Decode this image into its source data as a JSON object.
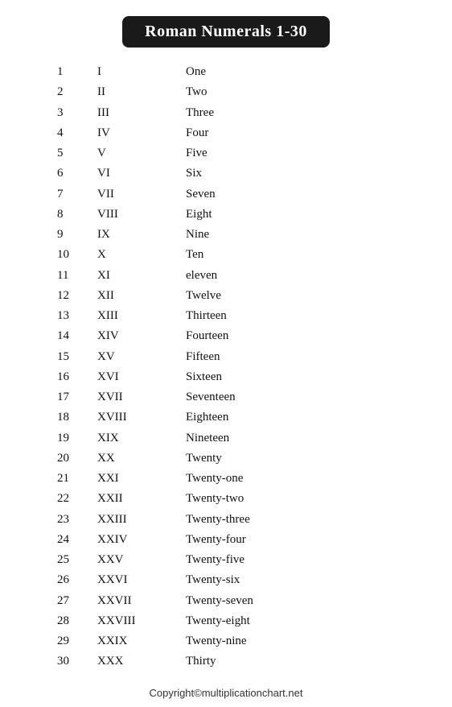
{
  "title": "Roman Numerals 1-30",
  "rows": [
    {
      "num": "1",
      "roman": "I",
      "word": "One"
    },
    {
      "num": "2",
      "roman": "II",
      "word": "Two"
    },
    {
      "num": "3",
      "roman": "III",
      "word": "Three"
    },
    {
      "num": "4",
      "roman": "IV",
      "word": "Four"
    },
    {
      "num": "5",
      "roman": "V",
      "word": "Five"
    },
    {
      "num": "6",
      "roman": "VI",
      "word": "Six"
    },
    {
      "num": "7",
      "roman": "VII",
      "word": "Seven"
    },
    {
      "num": "8",
      "roman": "VIII",
      "word": "Eight"
    },
    {
      "num": "9",
      "roman": "IX",
      "word": "Nine"
    },
    {
      "num": "10",
      "roman": "X",
      "word": "Ten"
    },
    {
      "num": "11",
      "roman": "XI",
      "word": "eleven"
    },
    {
      "num": "12",
      "roman": "XII",
      "word": "Twelve"
    },
    {
      "num": "13",
      "roman": "XIII",
      "word": "Thirteen"
    },
    {
      "num": "14",
      "roman": "XIV",
      "word": "Fourteen"
    },
    {
      "num": "15",
      "roman": "XV",
      "word": "Fifteen"
    },
    {
      "num": "16",
      "roman": "XVI",
      "word": "Sixteen"
    },
    {
      "num": "17",
      "roman": "XVII",
      "word": "Seventeen"
    },
    {
      "num": "18",
      "roman": "XVIII",
      "word": "Eighteen"
    },
    {
      "num": "19",
      "roman": "XIX",
      "word": "Nineteen"
    },
    {
      "num": "20",
      "roman": "XX",
      "word": "Twenty"
    },
    {
      "num": "21",
      "roman": "XXI",
      "word": "Twenty-one"
    },
    {
      "num": "22",
      "roman": "XXII",
      "word": "Twenty-two"
    },
    {
      "num": "23",
      "roman": "XXIII",
      "word": "Twenty-three"
    },
    {
      "num": "24",
      "roman": "XXIV",
      "word": "Twenty-four"
    },
    {
      "num": "25",
      "roman": "XXV",
      "word": "Twenty-five"
    },
    {
      "num": "26",
      "roman": "XXVI",
      "word": "Twenty-six"
    },
    {
      "num": "27",
      "roman": "XXVII",
      "word": "Twenty-seven"
    },
    {
      "num": "28",
      "roman": "XXVIII",
      "word": "Twenty-eight"
    },
    {
      "num": "29",
      "roman": "XXIX",
      "word": "Twenty-nine"
    },
    {
      "num": "30",
      "roman": "XXX",
      "word": "Thirty"
    }
  ],
  "footer": "Copyright©multiplicationchart.net"
}
